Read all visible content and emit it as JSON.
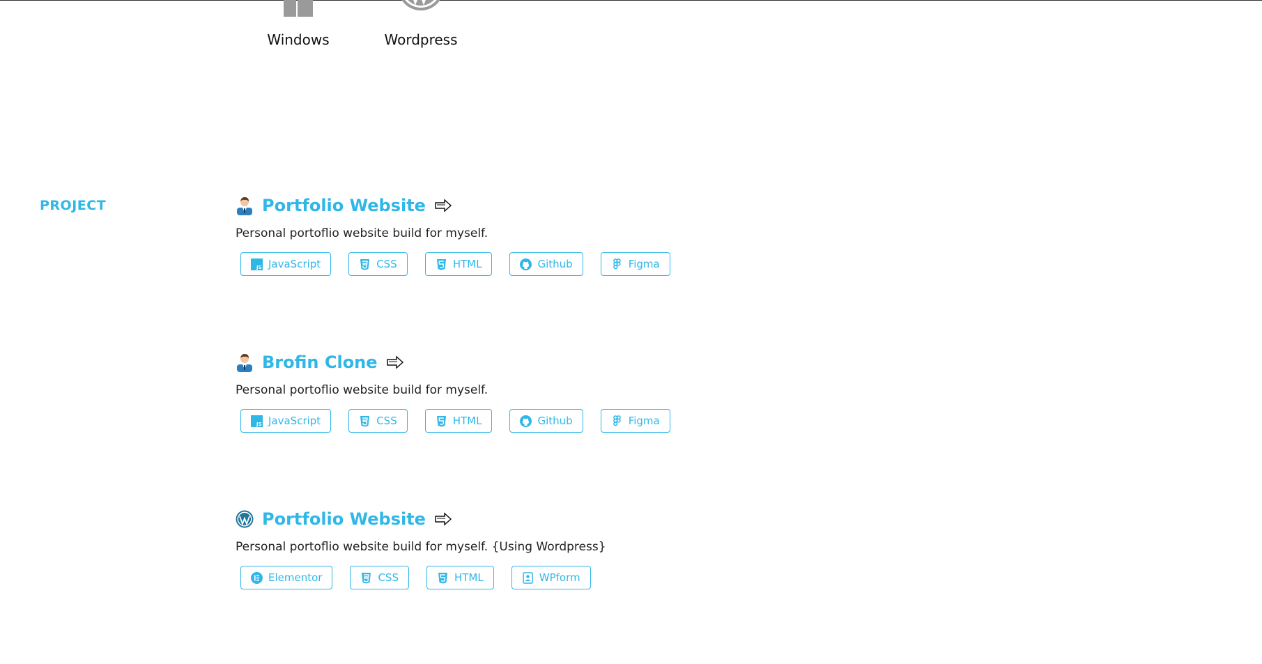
{
  "skills": [
    {
      "label": "Windows",
      "icon": "windows-logo-icon"
    },
    {
      "label": "Wordpress",
      "icon": "wordpress-logo-icon"
    }
  ],
  "section": {
    "label": "PROJECT"
  },
  "projects": [
    {
      "title": "Portfolio Website",
      "avatar": "developer-avatar-icon",
      "description": "Personal portoflio website build for myself.",
      "tags": [
        "JavaScript",
        "CSS",
        "HTML",
        "Github",
        "Figma"
      ]
    },
    {
      "title": "Brofin Clone",
      "avatar": "developer-avatar-icon",
      "description": "Personal portoflio website build for myself.",
      "tags": [
        "JavaScript",
        "CSS",
        "HTML",
        "Github",
        "Figma"
      ]
    },
    {
      "title": "Portfolio Website",
      "avatar": "wordpress-logo-icon",
      "description": "Personal portoflio website build for myself. {Using Wordpress}",
      "tags": [
        "Elementor",
        "CSS",
        "HTML",
        "WPform"
      ]
    }
  ],
  "colors": {
    "accent": "#2fb7e8",
    "text": "#222222"
  }
}
